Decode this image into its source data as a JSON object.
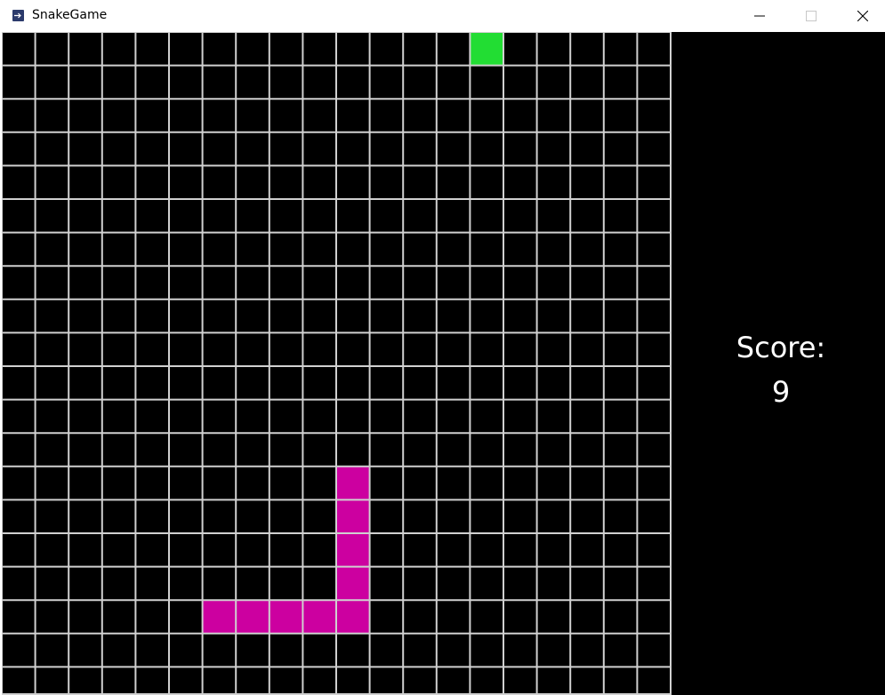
{
  "window": {
    "title": "SnakeGame",
    "controls": {
      "minimize_icon": "minimize-icon",
      "maximize_icon": "maximize-icon",
      "close_icon": "close-icon"
    }
  },
  "game": {
    "score_label": "Score:",
    "score_value": "9",
    "grid": {
      "columns": 20,
      "rows": 20,
      "background_color": "#000000",
      "line_color": "#d0d0d0"
    },
    "food": {
      "col": 14,
      "row": 0,
      "color": "#22dd33"
    },
    "snake": {
      "color": "#cc00a0",
      "segments": [
        {
          "col": 10,
          "row": 13
        },
        {
          "col": 10,
          "row": 14
        },
        {
          "col": 10,
          "row": 15
        },
        {
          "col": 10,
          "row": 16
        },
        {
          "col": 10,
          "row": 17
        },
        {
          "col": 9,
          "row": 17
        },
        {
          "col": 8,
          "row": 17
        },
        {
          "col": 7,
          "row": 17
        },
        {
          "col": 6,
          "row": 17
        }
      ]
    }
  }
}
